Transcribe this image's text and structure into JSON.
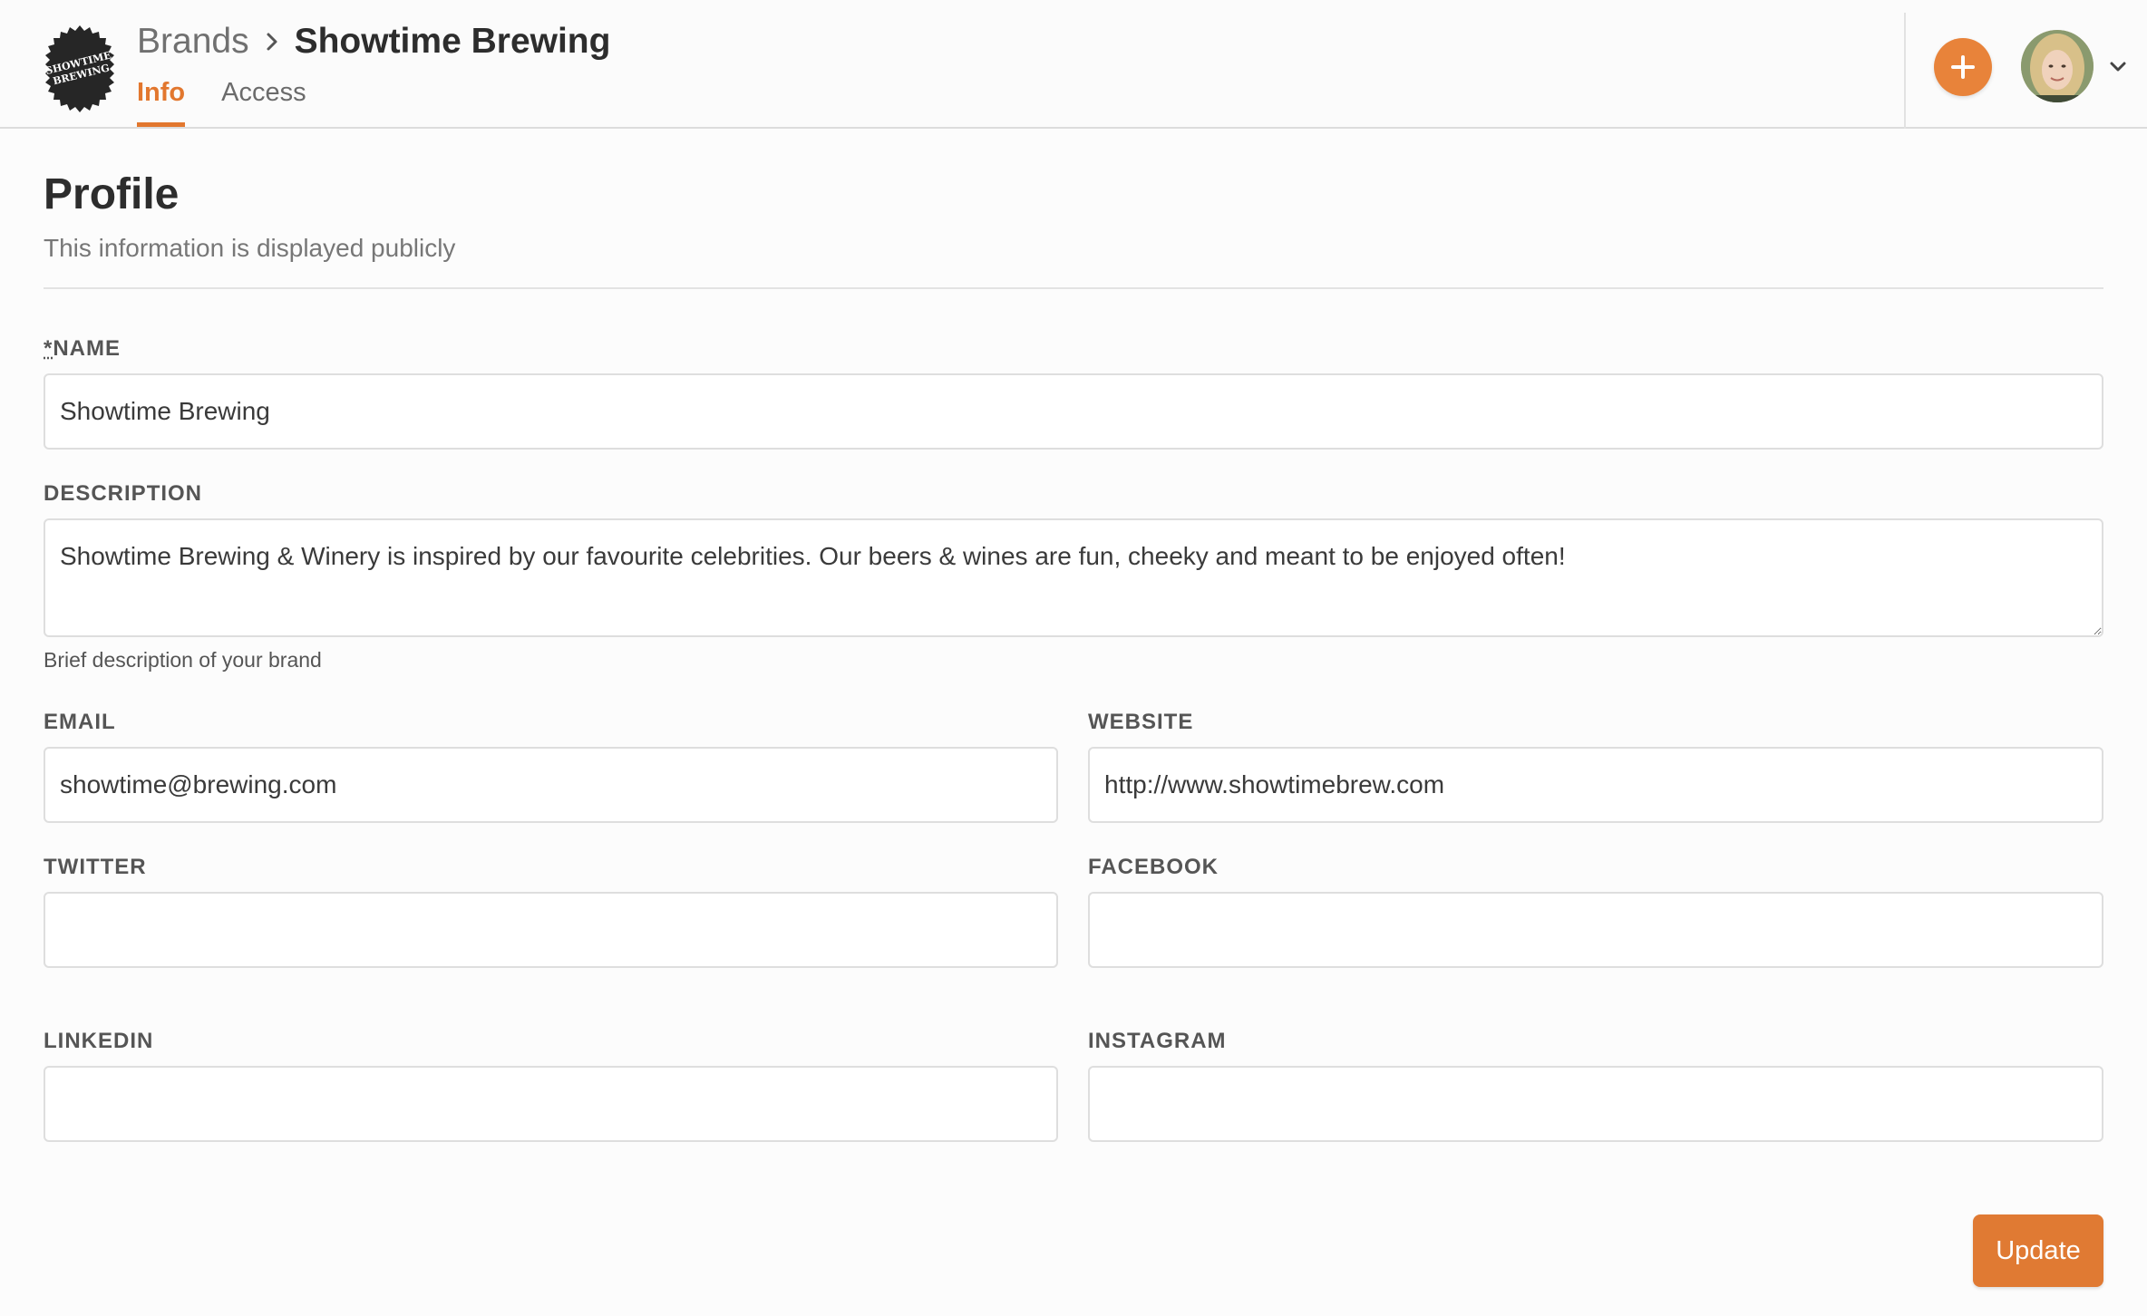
{
  "header": {
    "logo_text_line1": "SHOWTIME",
    "logo_text_line2": "BREWING",
    "breadcrumb_parent": "Brands",
    "breadcrumb_current": "Showtime Brewing",
    "tabs": [
      {
        "label": "Info",
        "active": true
      },
      {
        "label": "Access",
        "active": false
      }
    ],
    "add_icon": "plus-icon",
    "accent_color": "#e2772e"
  },
  "profile": {
    "title": "Profile",
    "subtitle": "This information is displayed publicly"
  },
  "form": {
    "name": {
      "star": "*",
      "label": "NAME",
      "value": "Showtime Brewing"
    },
    "description": {
      "label": "DESCRIPTION",
      "value": "Showtime Brewing & Winery is inspired by our favourite celebrities. Our beers & wines are fun, cheeky and meant to be enjoyed often!",
      "help": "Brief description of your brand"
    },
    "email": {
      "label": "EMAIL",
      "value": "showtime@brewing.com"
    },
    "website": {
      "label": "WEBSITE",
      "value": "http://www.showtimebrew.com"
    },
    "twitter": {
      "label": "TWITTER",
      "value": ""
    },
    "facebook": {
      "label": "FACEBOOK",
      "value": ""
    },
    "linkedin": {
      "label": "LINKEDIN",
      "value": ""
    },
    "instagram": {
      "label": "INSTAGRAM",
      "value": ""
    }
  },
  "actions": {
    "update_label": "Update"
  }
}
